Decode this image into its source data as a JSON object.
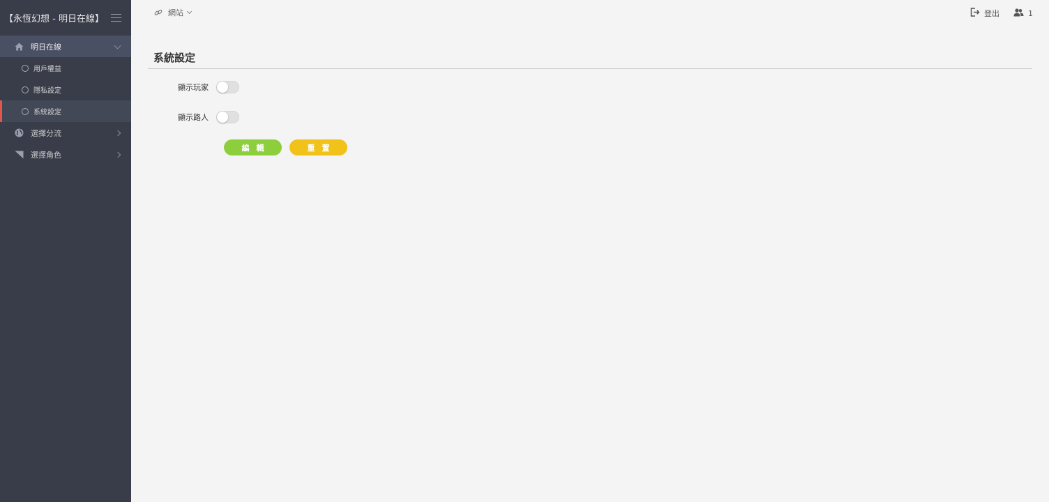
{
  "app": {
    "brand": "【永恆幻想 - 明日在線】"
  },
  "sidebar": {
    "items": [
      {
        "label": "明日在線",
        "icon": "home-icon"
      },
      {
        "label": "用戶權益",
        "icon": "circle-icon"
      },
      {
        "label": "隱私設定",
        "icon": "circle-icon"
      },
      {
        "label": "系統設定",
        "icon": "circle-icon"
      },
      {
        "label": "選擇分流",
        "icon": "globe-icon"
      },
      {
        "label": "選擇角色",
        "icon": "flag-icon"
      }
    ]
  },
  "header": {
    "site_label": "網站",
    "logout_label": "登出",
    "user_count": "1"
  },
  "main": {
    "title": "系統設定",
    "fields": [
      {
        "label": "顯示玩家",
        "on": false
      },
      {
        "label": "顯示路人",
        "on": false
      }
    ],
    "edit_label": "編輯",
    "reset_label": "重置"
  },
  "colors": {
    "sidebar_bg": "#393d49",
    "active_marker": "#e2574b",
    "edit_button": "#8dce3d",
    "reset_button": "#f0c21a"
  }
}
